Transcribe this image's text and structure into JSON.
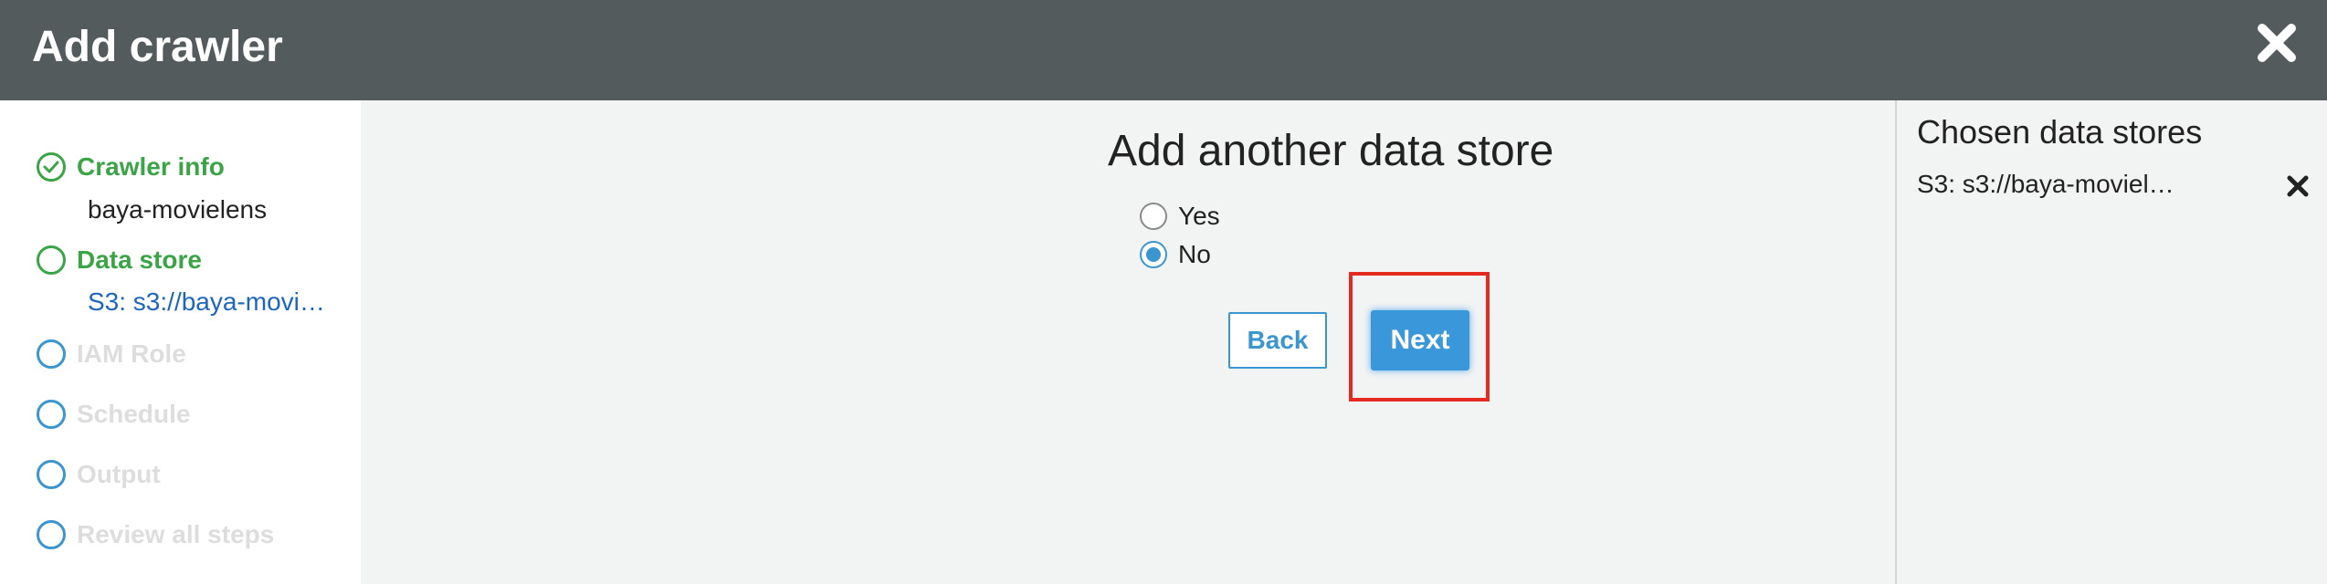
{
  "header": {
    "title": "Add crawler"
  },
  "sidebar": {
    "steps": [
      {
        "label": "Crawler info",
        "sub": "baya-movielens"
      },
      {
        "label": "Data store",
        "sub": "S3: s3://baya-movi…"
      },
      {
        "label": "IAM Role"
      },
      {
        "label": "Schedule"
      },
      {
        "label": "Output"
      },
      {
        "label": "Review all steps"
      }
    ]
  },
  "main": {
    "title": "Add another data store",
    "options": [
      {
        "label": "Yes",
        "checked": false
      },
      {
        "label": "No",
        "checked": true
      }
    ],
    "back_label": "Back",
    "next_label": "Next"
  },
  "right_panel": {
    "title": "Chosen data stores",
    "items": [
      {
        "label": "S3: s3://baya-moviel…"
      }
    ]
  },
  "colors": {
    "header_bg": "#545b5d",
    "accent": "#3b96cf",
    "complete": "#3aa447",
    "highlight": "#e52a22"
  },
  "icons": [
    "close-icon",
    "check-icon",
    "remove-icon"
  ]
}
